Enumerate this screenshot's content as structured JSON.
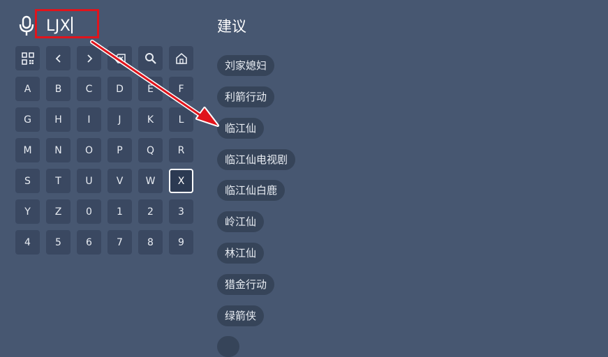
{
  "search": {
    "query": "LJX",
    "mic_icon": "microphone-icon"
  },
  "keyboard": {
    "function_keys": [
      {
        "name": "qr-code-icon",
        "label": ""
      },
      {
        "name": "left-arrow-icon",
        "label": "<"
      },
      {
        "name": "right-arrow-icon",
        "label": ">"
      },
      {
        "name": "backspace-icon",
        "label": ""
      },
      {
        "name": "search-icon",
        "label": ""
      },
      {
        "name": "home-icon",
        "label": ""
      }
    ],
    "rows": [
      [
        "A",
        "B",
        "C",
        "D",
        "E",
        "F"
      ],
      [
        "G",
        "H",
        "I",
        "J",
        "K",
        "L"
      ],
      [
        "M",
        "N",
        "O",
        "P",
        "Q",
        "R"
      ],
      [
        "S",
        "T",
        "U",
        "V",
        "W",
        "X"
      ],
      [
        "Y",
        "Z",
        "0",
        "1",
        "2",
        "3"
      ],
      [
        "4",
        "5",
        "6",
        "7",
        "8",
        "9"
      ]
    ],
    "selected_key": "X"
  },
  "suggestions": {
    "title": "建议",
    "items": [
      "刘家媳妇",
      "利箭行动",
      "临江仙",
      "临江仙电视剧",
      "临江仙白鹿",
      "岭江仙",
      "林江仙",
      "猎金行动",
      "绿箭侠"
    ]
  },
  "colors": {
    "background": "#475771",
    "key": "#3a4861",
    "chip": "#364459",
    "annotation_red": "#e0141c"
  }
}
